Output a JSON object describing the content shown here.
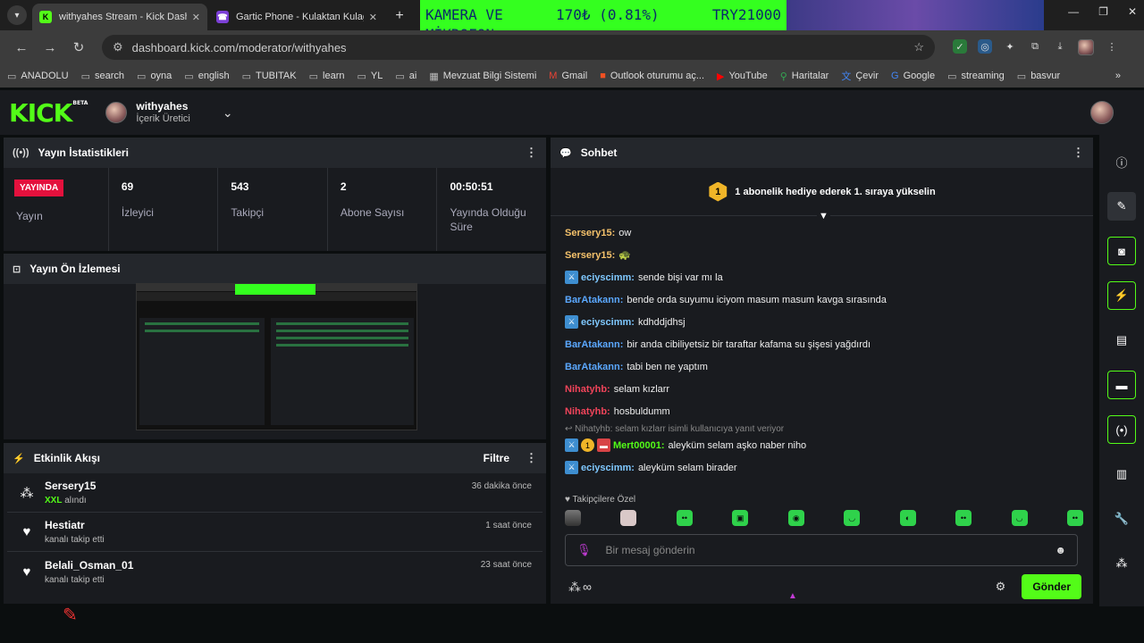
{
  "browser": {
    "tabs": [
      {
        "title": "withyahes Stream - Kick Dashbo",
        "active": true,
        "favicon": "K"
      },
      {
        "title": "Gartic Phone - Kulaktan Kulağa",
        "active": false,
        "favicon": "☎"
      }
    ],
    "url": "dashboard.kick.com/moderator/withyahes",
    "banner": {
      "line1_left": "KAMERA VE",
      "line1_mid": "170₺ (0.81%)",
      "line1_right": "TRY21000",
      "line2": "MİKROFON"
    },
    "bookmarks": [
      "ANADOLU",
      "search",
      "oyna",
      "english",
      "TUBITAK",
      "learn",
      "YL",
      "ai",
      "Mevzuat Bilgi Sistemi",
      "Gmail",
      "Outlook oturumu aç...",
      "YouTube",
      "Haritalar",
      "Çevir",
      "Google",
      "streaming",
      "basvur"
    ]
  },
  "header": {
    "logo": "KICK",
    "logo_tag": "BETA",
    "channel_name": "withyahes",
    "channel_role": "İçerik Üretici"
  },
  "stats": {
    "title": "Yayın İstatistikleri",
    "live_label": "YAYINDA",
    "live_sub": "Yayın",
    "items": [
      {
        "value": "69",
        "label": "İzleyici"
      },
      {
        "value": "543",
        "label": "Takipçi"
      },
      {
        "value": "2",
        "label": "Abone Sayısı"
      },
      {
        "value": "00:50:51",
        "label": "Yayında Olduğu Süre"
      }
    ]
  },
  "preview": {
    "title": "Yayın Ön İzlemesi"
  },
  "activity": {
    "title": "Etkinlik Akışı",
    "filter_label": "Filtre",
    "items": [
      {
        "name": "Sersery15",
        "highlight": "XXL",
        "sub": "alındı",
        "time": "36 dakika önce",
        "icon": "gift-icon"
      },
      {
        "name": "Hestiatr",
        "highlight": "",
        "sub": "kanalı takip etti",
        "time": "1 saat önce",
        "icon": "heart-icon"
      },
      {
        "name": "Belali_Osman_01",
        "highlight": "",
        "sub": "kanalı takip etti",
        "time": "23 saat önce",
        "icon": "heart-icon"
      }
    ]
  },
  "chat": {
    "title": "Sohbet",
    "pinned_badge": "1",
    "pinned_text": "1 abonelik hediye ederek 1. sıraya yükselin",
    "messages": [
      {
        "user": "Sersery15",
        "color": "#f5c26b",
        "text": "ow",
        "badges": []
      },
      {
        "user": "Sersery15",
        "color": "#f5c26b",
        "text": "🐢",
        "badges": []
      },
      {
        "user": "eciyscimm",
        "color": "#7fc8ff",
        "text": "sende bişi var mı la",
        "badges": [
          "mod"
        ]
      },
      {
        "user": "BarAtakann",
        "color": "#5ba8ff",
        "text": "bende orda suyumu iciyom masum masum kavga sırasında",
        "badges": []
      },
      {
        "user": "eciyscimm",
        "color": "#7fc8ff",
        "text": "kdhddjdhsj",
        "badges": [
          "mod"
        ]
      },
      {
        "user": "BarAtakann",
        "color": "#5ba8ff",
        "text": "bir anda cibiliyetsiz bir taraftar kafama su şişesi yağdırdı",
        "badges": []
      },
      {
        "user": "BarAtakann",
        "color": "#5ba8ff",
        "text": "tabi ben ne yaptım",
        "badges": []
      },
      {
        "user": "Nihatyhb",
        "color": "#f0445a",
        "text": "selam kızlarr",
        "badges": []
      },
      {
        "user": "Nihatyhb",
        "color": "#f0445a",
        "text": "hosbuldumm",
        "badges": []
      }
    ],
    "reply_note": "Nihatyhb: selam kızlarr isimli kullanıcıya yanıt veriyor",
    "messages2": [
      {
        "user": "Mert00001",
        "color": "#53fc18",
        "text": "aleyküm selam aşko naber niho",
        "badges": [
          "mod",
          "sub",
          "gift"
        ]
      },
      {
        "user": "eciyscimm",
        "color": "#7fc8ff",
        "text": "aleyküm selam birader",
        "badges": [
          "mod"
        ]
      }
    ],
    "emote_label": "Takipçilere Özel",
    "input_placeholder": "Bir mesaj gönderin",
    "send_label": "Gönder",
    "infinity": "∞"
  },
  "colors": {
    "brand": "#53fc18",
    "live": "#e4113d",
    "bg": "#0b0e0f",
    "panel": "#191b1f"
  }
}
